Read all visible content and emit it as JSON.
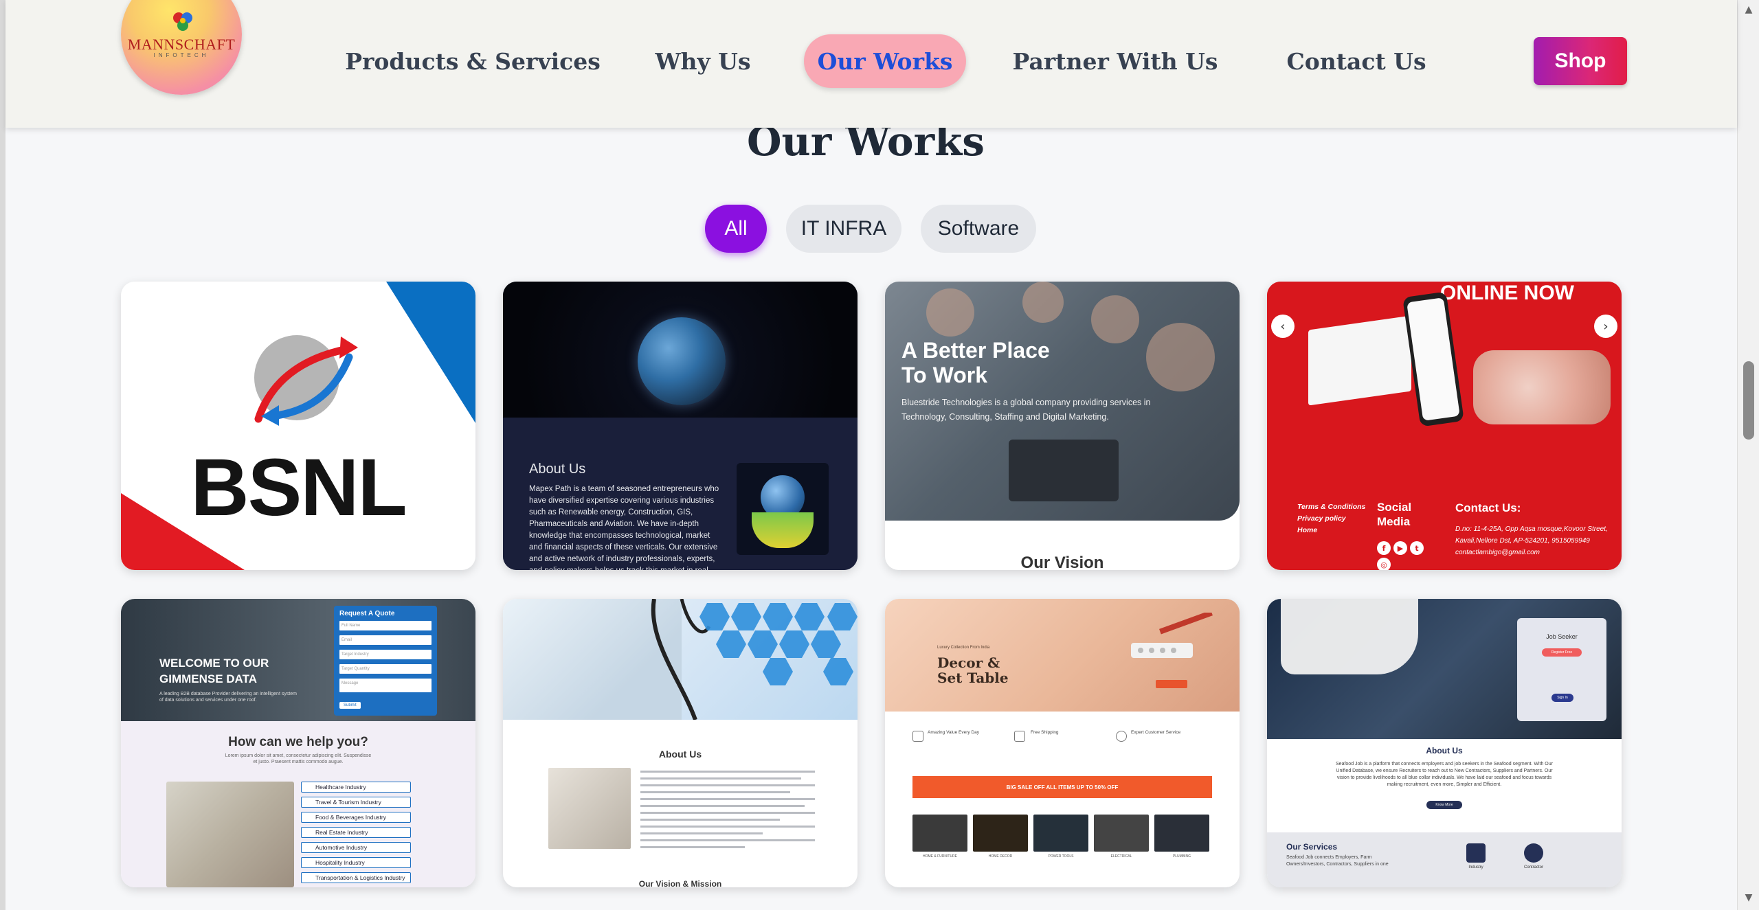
{
  "header": {
    "logo_text": "MANNSCHAFT",
    "logo_subtext": "INFOTECH",
    "nav": [
      {
        "label": "Products & Services"
      },
      {
        "label": "Why Us"
      },
      {
        "label": "Our Works"
      },
      {
        "label": "Partner With Us"
      },
      {
        "label": "Contact Us"
      }
    ],
    "active_nav": "Our Works",
    "shop_label": "Shop"
  },
  "section": {
    "title": "Our Works",
    "filters": [
      "All",
      "IT INFRA",
      "Software"
    ],
    "active_filter": "All"
  },
  "cards": {
    "bsnl": {
      "logo_text": "BSNL"
    },
    "mapex": {
      "heading": "About Us",
      "body": "Mapex Path is a team of seasoned entrepreneurs who have diversified expertise covering various industries such as Renewable energy, Construction, GIS, Pharmaceuticals and Aviation. We have in-depth knowledge that encompasses technological, market and financial aspects of these verticals. Our extensive and active network of industry professionals, experts, and policy makers helps us track this market in real time. Our knowledge driven, analytical and"
    },
    "bluestride": {
      "heading_line1": "A Better Place",
      "heading_line2": "To Work",
      "body": "Bluestride Technologies is a global company providing services in Technology, Consulting, Staffing and Digital Marketing.",
      "vision": "Our Vision"
    },
    "lambigo": {
      "banner": "ONLINE NOW",
      "links": [
        "Terms & Conditions",
        "Privacy policy",
        "Home"
      ],
      "social_line1": "Social",
      "social_line2": "Media",
      "contact_heading": "Contact Us:",
      "address": "D.no: 11-4-25A, Opp Aqsa mosque,Kovoor Street, Kavali,Nellore Dst, AP-524201, 9515059949 contactlambigo@gmail.com"
    },
    "gimmense": {
      "heading_line1": "WELCOME TO OUR",
      "heading_line2": "GIMMENSE DATA",
      "subtext": "A leading B2B database Provider delivering an intelligent system of data solutions and services under one roof.",
      "form_title": "Request A Quote",
      "form_fields": [
        "Full Name",
        "Email",
        "Target Industry",
        "Target Quantity",
        "Message"
      ],
      "submit": "Submit",
      "help_heading": "How can we help you?",
      "help_sub": "Lorem ipsum dolor sit amet, consectetur adipiscing elit. Suspendisse et justo. Praesent mattis commodo augue.",
      "industries": [
        "Healthcare Industry",
        "Travel & Tourism Industry",
        "Food & Beverages Industry",
        "Real Estate Industry",
        "Automotive Industry",
        "Hospitality Industry",
        "Transportation & Logistics Industry"
      ]
    },
    "ortho": {
      "heading": "About Us",
      "vision": "Our Vision & Mission"
    },
    "decor": {
      "eyebrow": "Luxury Collection From India",
      "title_line1": "Decor &",
      "title_line2": "Set Table",
      "features": [
        "Amazing Value Every Day",
        "Free Shipping",
        "Expert Customer Service"
      ],
      "sale_banner": "BIG SALE OFF ALL ITEMS UP TO 50% OFF",
      "thumb_labels": [
        "HOME & FURNITURE",
        "HOME DECOR",
        "POWER TOOLS",
        "ELECTRICAL",
        "PLUMBING"
      ]
    },
    "seafood": {
      "card_title": "Job Seeker",
      "register": "Register Free",
      "signin": "Sign In",
      "heading": "About Us",
      "body": "Seafood Job is a platform that connects employers and job seekers in the Seafood segment. With Our Unified Database, we ensure Recruiters to reach out to New Contractors, Suppliers and Partners. Our vision to provide livelihoods to all blue collar individuals. We have laid our seafood and focus towards making recruitment, even more, Simpler and Efficient.",
      "know_more": "Know More",
      "services_heading": "Our Services",
      "services_body": "Seafood Job connects Employers, Farm Owners/Investors, Contractors, Suppliers in one",
      "service_labels": [
        "Industry",
        "Contractor"
      ]
    }
  },
  "colors": {
    "accent_purple": "#8b10e0",
    "nav_active_bg": "#f9a8b4",
    "nav_active_text": "#1d4ed8",
    "shop_gradient_start": "#a21caf",
    "shop_gradient_end": "#e11d48"
  },
  "icons": [
    "logo-mark-icon",
    "chevron-left-icon",
    "chevron-right-icon",
    "facebook-icon",
    "youtube-icon",
    "twitter-icon",
    "instagram-icon",
    "scroll-up-icon",
    "scroll-down-icon"
  ]
}
